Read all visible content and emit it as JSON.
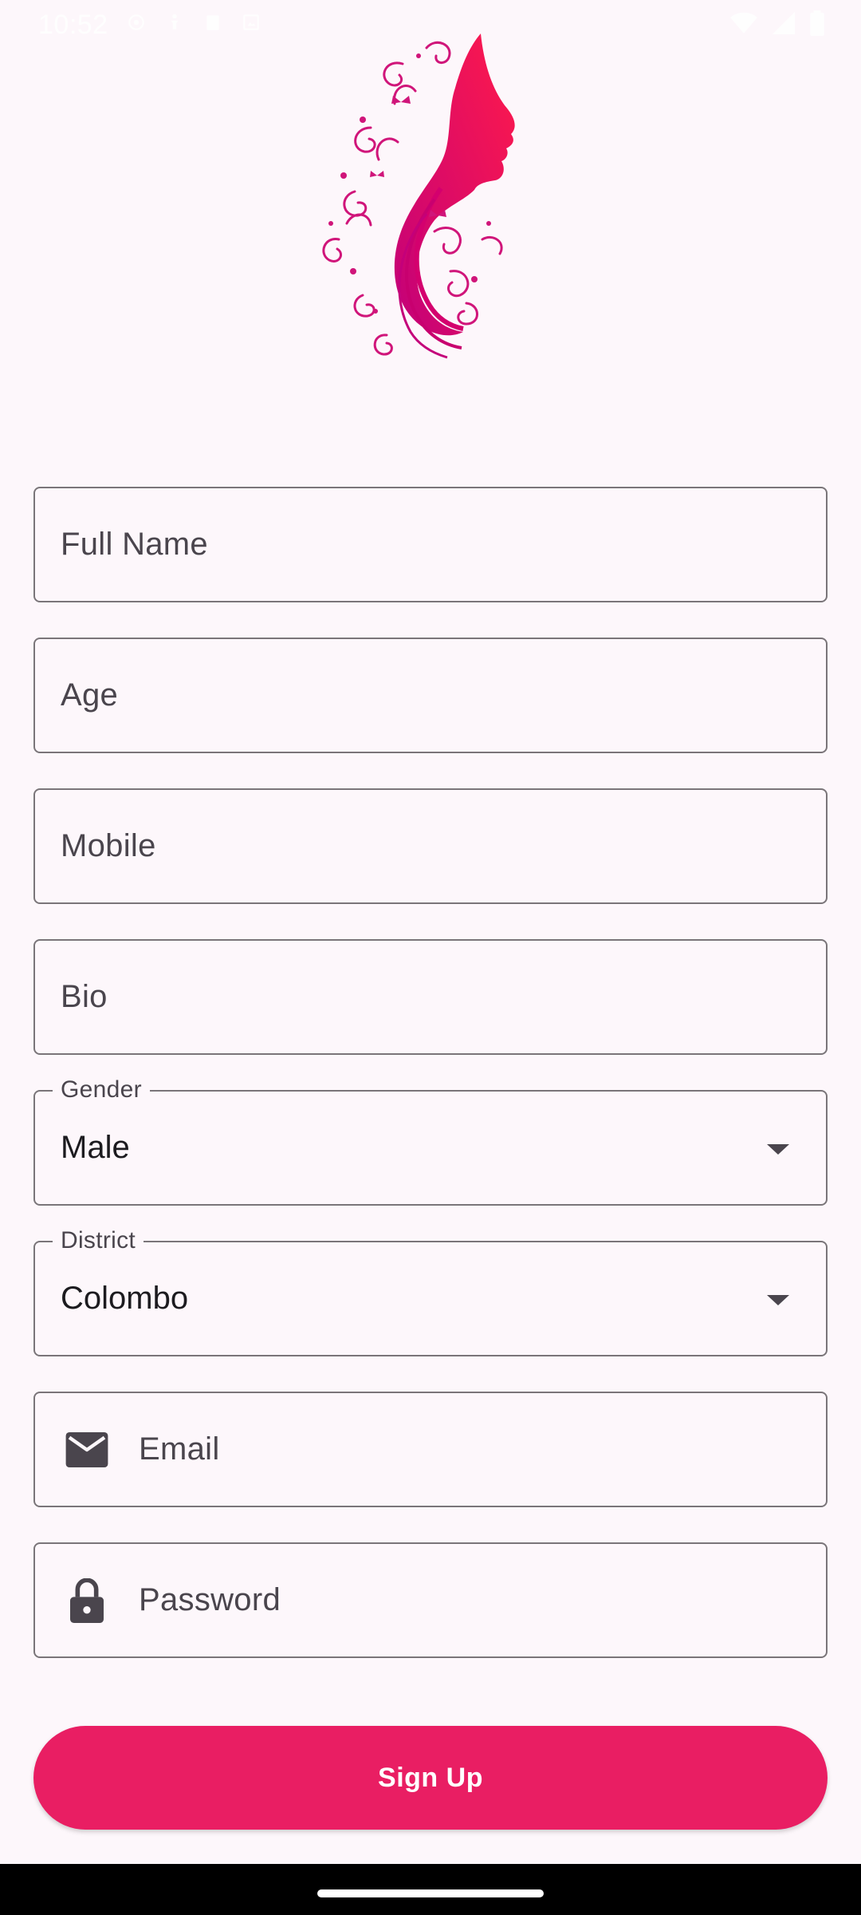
{
  "status_bar": {
    "time": "10:52",
    "icons": [
      "location-icon",
      "accessibility-icon",
      "clipboard-icon",
      "screenshot-icon",
      "wifi-icon",
      "signal-icon",
      "battery-icon"
    ]
  },
  "logo": {
    "icon": "woman-silhouette-logo"
  },
  "form": {
    "full_name": {
      "placeholder": "Full Name"
    },
    "age": {
      "placeholder": "Age"
    },
    "mobile": {
      "placeholder": "Mobile"
    },
    "bio": {
      "placeholder": "Bio"
    },
    "gender": {
      "label": "Gender",
      "value": "Male",
      "icon": "chevron-down-icon"
    },
    "district": {
      "label": "District",
      "value": "Colombo",
      "icon": "chevron-down-icon"
    },
    "email": {
      "placeholder": "Email",
      "icon": "email-icon"
    },
    "password": {
      "placeholder": "Password",
      "icon": "lock-icon"
    }
  },
  "signup_button": {
    "label": "Sign Up"
  },
  "colors": {
    "accent": "#e91e63",
    "background": "#fdf7fb",
    "outline": "#7a7579",
    "text": "#4a454d"
  }
}
